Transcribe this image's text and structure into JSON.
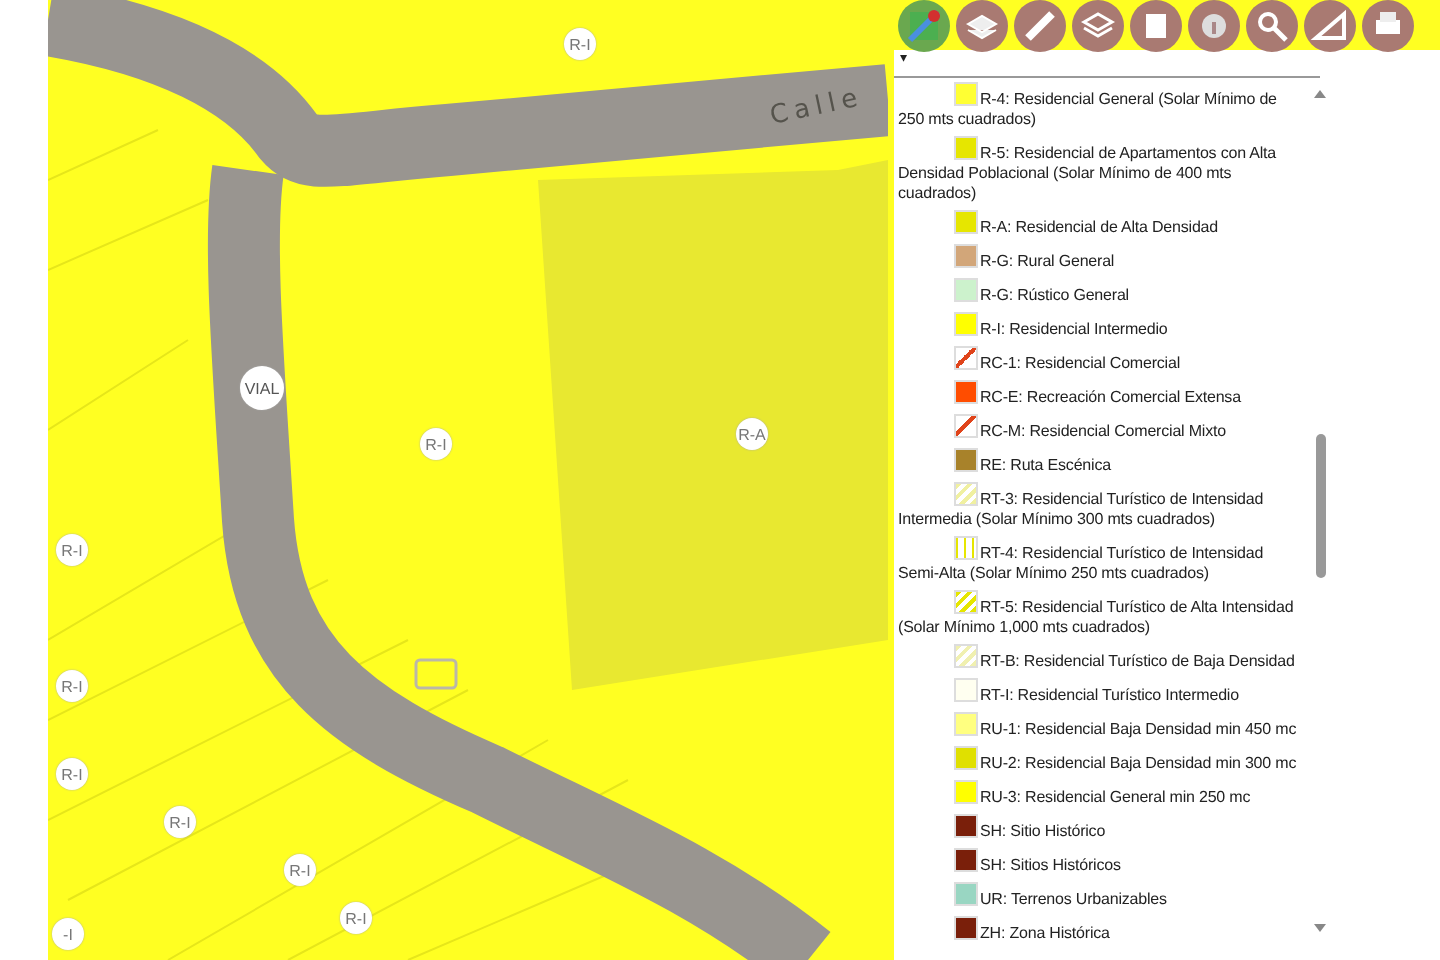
{
  "map": {
    "street_label": "Calle",
    "zone_labels": [
      {
        "text": "R-I",
        "kind": "circle"
      },
      {
        "text": "VIAL",
        "kind": "circle"
      },
      {
        "text": "R-I",
        "kind": "circle"
      },
      {
        "text": "R-A",
        "kind": "circle"
      },
      {
        "text": "R-I",
        "kind": "circle"
      },
      {
        "text": "R-I",
        "kind": "circle"
      },
      {
        "text": "R-I",
        "kind": "circle"
      },
      {
        "text": "R-I",
        "kind": "circle"
      },
      {
        "text": "R-I",
        "kind": "circle"
      },
      {
        "text": "R-I",
        "kind": "circle"
      },
      {
        "text": "-I",
        "kind": "circle"
      }
    ]
  },
  "legend": {
    "dropdown": "▾",
    "items": [
      {
        "label": "R-4: Residencial General (Solar Mínimo de 250 mts cuadrados)",
        "kind": "solid",
        "color": "#ffff33"
      },
      {
        "label": "R-5: Residencial de Apartamentos con Alta Densidad Poblacional (Solar Mínimo de 400 mts cuadrados)",
        "kind": "solid",
        "color": "#e6e600"
      },
      {
        "label": "R-A: Residencial de Alta Densidad",
        "kind": "solid",
        "color": "#e6e600"
      },
      {
        "label": "R-G: Rural General",
        "kind": "solid",
        "color": "#d2a679"
      },
      {
        "label": "R-G: Rústico General",
        "kind": "solid",
        "color": "#ccf2cc"
      },
      {
        "label": "R-I: Residencial Intermedio",
        "kind": "solid",
        "color": "#ffff00"
      },
      {
        "label": "RC-1: Residencial Comercial",
        "kind": "marker",
        "color": "#e0441b"
      },
      {
        "label": "RC-E: Recreación Comercial Extensa",
        "kind": "solid",
        "color": "#ff4d00"
      },
      {
        "label": "RC-M: Residencial Comercial Mixto",
        "kind": "marker",
        "color": "#e0441b"
      },
      {
        "label": "RE: Ruta Escénica",
        "kind": "solid",
        "color": "#a8822a"
      },
      {
        "label": "RT-3: Residencial Turístico de Intensidad Intermedia (Solar Mínimo 300 mts cuadrados)",
        "kind": "hatch",
        "color": "#f0f0a0"
      },
      {
        "label": "RT-4: Residencial Turístico de Intensidad Semi-Alta (Solar Mínimo 250 mts cuadrados)",
        "kind": "stripes",
        "color": "#e6e600"
      },
      {
        "label": "RT-5: Residencial Turístico de Alta Intensidad (Solar Mínimo 1,000 mts cuadrados)",
        "kind": "hatch",
        "color": "#e6e600"
      },
      {
        "label": "RT-B: Residencial Turístico de Baja Densidad",
        "kind": "hatch",
        "color": "#f0f0b0"
      },
      {
        "label": "RT-I: Residencial Turístico Intermedio",
        "kind": "solid",
        "color": "#fffff0"
      },
      {
        "label": "RU-1: Residencial Baja Densidad min 450 mc",
        "kind": "solid",
        "color": "#ffff80"
      },
      {
        "label": "RU-2: Residencial Baja Densidad min 300 mc",
        "kind": "solid",
        "color": "#e0e000"
      },
      {
        "label": "RU-3: Residencial General min 250 mc",
        "kind": "solid",
        "color": "#ffff00"
      },
      {
        "label": "SH: Sitio Histórico",
        "kind": "solid",
        "color": "#7a1f0a"
      },
      {
        "label": "SH: Sitios Históricos",
        "kind": "solid",
        "color": "#7a1f0a"
      },
      {
        "label": "UR: Terrenos Urbanizables",
        "kind": "solid",
        "color": "#99d6c2"
      },
      {
        "label": "ZH: Zona Histórica",
        "kind": "solid",
        "color": "#7a1f0a"
      }
    ]
  }
}
